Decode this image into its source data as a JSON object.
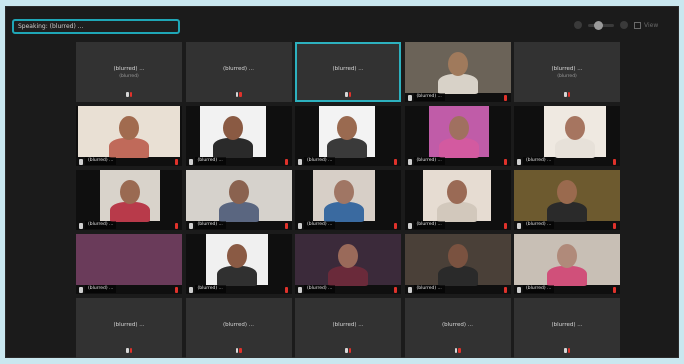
{
  "topbar": {
    "speaking_label": "Speaking: (blurred) ...",
    "view_label": "View"
  },
  "tiles": [
    {
      "kind": "name",
      "name": "(blurred) ...",
      "sub": "(blurred)"
    },
    {
      "kind": "name",
      "name": "(blurred) ...",
      "sub": ""
    },
    {
      "kind": "name",
      "name": "(blurred) ...",
      "sub": "",
      "active": true
    },
    {
      "kind": "video",
      "label": "(blurred) ..."
    },
    {
      "kind": "name",
      "name": "(blurred) ...",
      "sub": "(blurred)"
    },
    {
      "kind": "video",
      "label": "(blurred) ..."
    },
    {
      "kind": "video",
      "label": "(blurred) ..."
    },
    {
      "kind": "video",
      "label": "(blurred) ..."
    },
    {
      "kind": "video",
      "label": "(blurred) ..."
    },
    {
      "kind": "video",
      "label": "(blurred) ..."
    },
    {
      "kind": "video",
      "label": "(blurred) ..."
    },
    {
      "kind": "video",
      "label": "(blurred) ..."
    },
    {
      "kind": "video",
      "label": "(blurred) ..."
    },
    {
      "kind": "video",
      "label": "(blurred) ..."
    },
    {
      "kind": "video",
      "label": "(blurred) ..."
    },
    {
      "kind": "video",
      "label": "(blurred) ..."
    },
    {
      "kind": "video",
      "label": "(blurred) ..."
    },
    {
      "kind": "video",
      "label": "(blurred) ..."
    },
    {
      "kind": "video",
      "label": "(blurred) ..."
    },
    {
      "kind": "video",
      "label": "(blurred) ..."
    },
    {
      "kind": "name",
      "name": "(blurred) ...",
      "sub": ""
    },
    {
      "kind": "name",
      "name": "(blurred) ...",
      "sub": ""
    },
    {
      "kind": "name",
      "name": "(blurred) ...",
      "sub": ""
    },
    {
      "kind": "name",
      "name": "(blurred) ...",
      "sub": ""
    },
    {
      "kind": "name",
      "name": "(blurred) ...",
      "sub": ""
    }
  ],
  "colors": {
    "accent": "#2db1bf",
    "tile_bg": "#323232",
    "mic_muted": "#e0322b",
    "window_bg": "#1b1b1b",
    "page_bg": "#c9e7ef"
  }
}
